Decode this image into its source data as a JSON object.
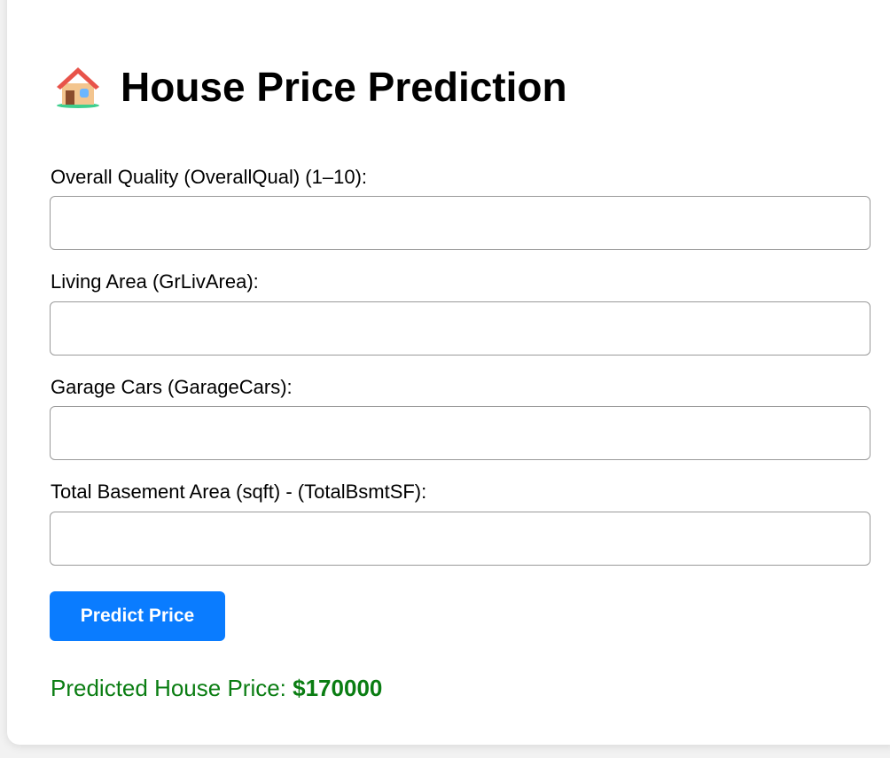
{
  "header": {
    "icon": "house-icon",
    "title": "House Price Prediction"
  },
  "form": {
    "fields": [
      {
        "label": "Overall Quality (OverallQual) (1–10):",
        "value": "",
        "placeholder": ""
      },
      {
        "label": "Living Area (GrLivArea):",
        "value": "",
        "placeholder": ""
      },
      {
        "label": "Garage Cars (GarageCars):",
        "value": "",
        "placeholder": ""
      },
      {
        "label": "Total Basement Area (sqft) - (TotalBsmtSF):",
        "value": "",
        "placeholder": ""
      }
    ],
    "submit_label": "Predict Price"
  },
  "result": {
    "label": "Predicted House Price: ",
    "value": "$170000"
  },
  "colors": {
    "button": "#0a7cff",
    "result_text": "#0a7d12"
  }
}
